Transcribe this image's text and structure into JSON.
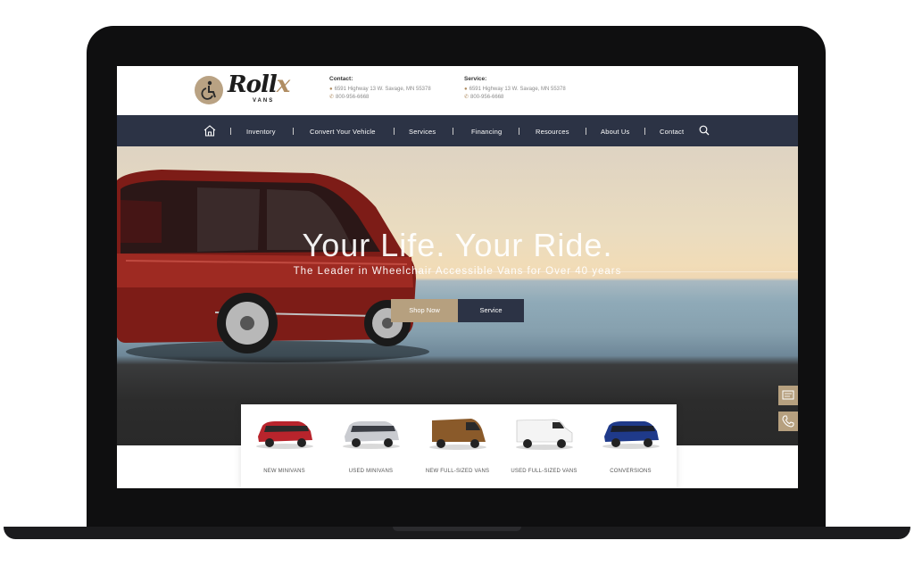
{
  "header": {
    "logo_text": "Roll",
    "logo_x": "x",
    "logo_sub": "VANS",
    "contact": {
      "title": "Contact:",
      "address": "6591 Highway 13 W. Savage, MN 55378",
      "phone": "800-956-6668"
    },
    "service": {
      "title": "Service:",
      "address": "6591 Highway 13 W. Savage, MN 55378",
      "phone": "800-956-6668"
    }
  },
  "nav": {
    "items": [
      "Inventory",
      "Convert Your Vehicle",
      "Services",
      "Financing",
      "Resources",
      "About Us",
      "Contact"
    ],
    "home_icon": "home-icon",
    "search_icon": "search-icon"
  },
  "hero": {
    "title": "Your Life. Your Ride.",
    "subtitle": "The Leader in Wheelchair Accessible Vans for Over 40 years",
    "shop_label": "Shop Now",
    "service_label": "Service"
  },
  "side_tabs": [
    "chat-icon",
    "phone-icon"
  ],
  "categories": [
    {
      "label": "NEW MINIVANS",
      "color": "#b8242c"
    },
    {
      "label": "USED MINIVANS",
      "color": "#c9cbd0"
    },
    {
      "label": "NEW FULL-SIZED VANS",
      "color": "#8a5a2a"
    },
    {
      "label": "USED FULL-SIZED VANS",
      "color": "#f4f4f4"
    },
    {
      "label": "CONVERSIONS",
      "color": "#1f3a8a"
    }
  ],
  "colors": {
    "nav_bg": "#2c3345",
    "accent": "#b6a07f"
  }
}
